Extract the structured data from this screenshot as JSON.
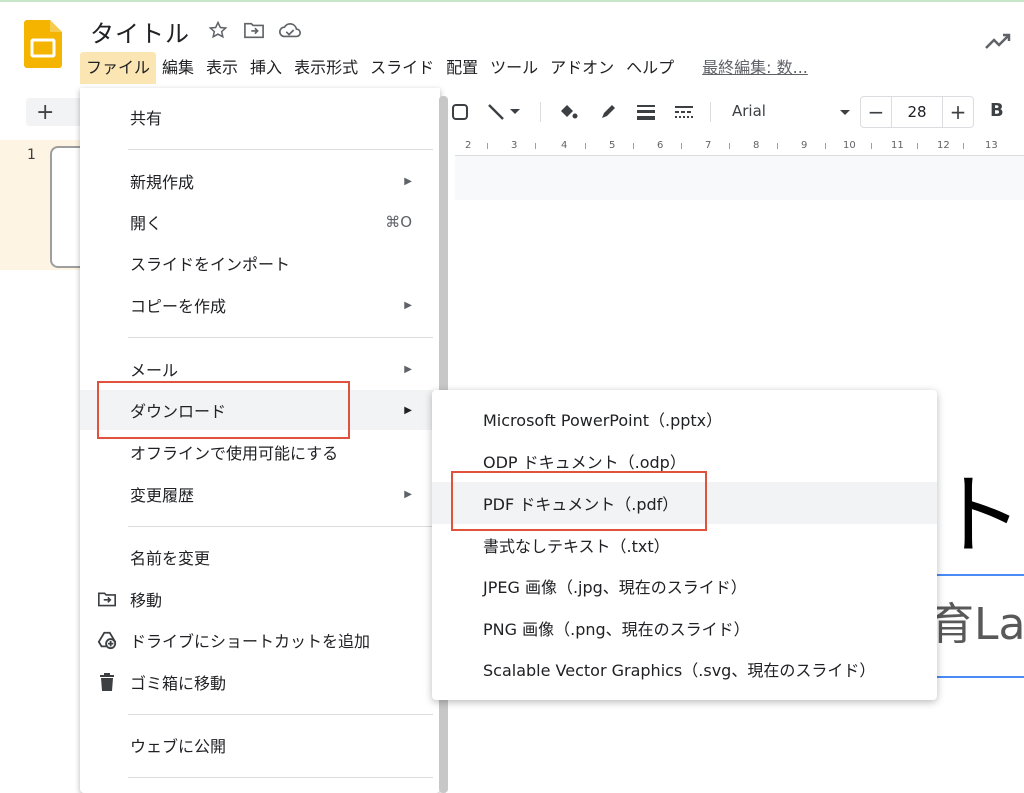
{
  "app": {
    "title": "タイトル",
    "last_edit": "最終編集: 数..."
  },
  "menubar": [
    "ファイル",
    "編集",
    "表示",
    "挿入",
    "表示形式",
    "スライド",
    "配置",
    "ツール",
    "アドオン",
    "ヘルプ"
  ],
  "toolbar": {
    "font": "Arial",
    "font_size": "28",
    "bold_label": "B",
    "add_label": "+"
  },
  "ruler": [
    "2",
    "3",
    "4",
    "5",
    "6",
    "7",
    "8",
    "9",
    "10",
    "11",
    "12",
    "13"
  ],
  "filmstrip": {
    "slide_number": "1"
  },
  "slide": {
    "title_fragment": "ト",
    "subtitle_fragment": "育La"
  },
  "file_menu": {
    "share": "共有",
    "new": "新規作成",
    "open": "開く",
    "open_shortcut": "⌘O",
    "import_slides": "スライドをインポート",
    "make_copy": "コピーを作成",
    "email": "メール",
    "download": "ダウンロード",
    "offline": "オフラインで使用可能にする",
    "version_history": "変更履歴",
    "rename": "名前を変更",
    "move": "移動",
    "add_shortcut": "ドライブにショートカットを追加",
    "trash": "ゴミ箱に移動",
    "publish": "ウェブに公開"
  },
  "download_menu": [
    "Microsoft PowerPoint（.pptx）",
    "ODP ドキュメント（.odp）",
    "PDF ドキュメント（.pdf）",
    "書式なしテキスト（.txt）",
    "JPEG 画像（.jpg、現在のスライド）",
    "PNG 画像（.png、現在のスライド）",
    "Scalable Vector Graphics（.svg、現在のスライド）"
  ],
  "colors": {
    "accent_yellow": "#f4b400",
    "highlight_red": "#e1523d",
    "menu_active": "#fbe6b3"
  }
}
